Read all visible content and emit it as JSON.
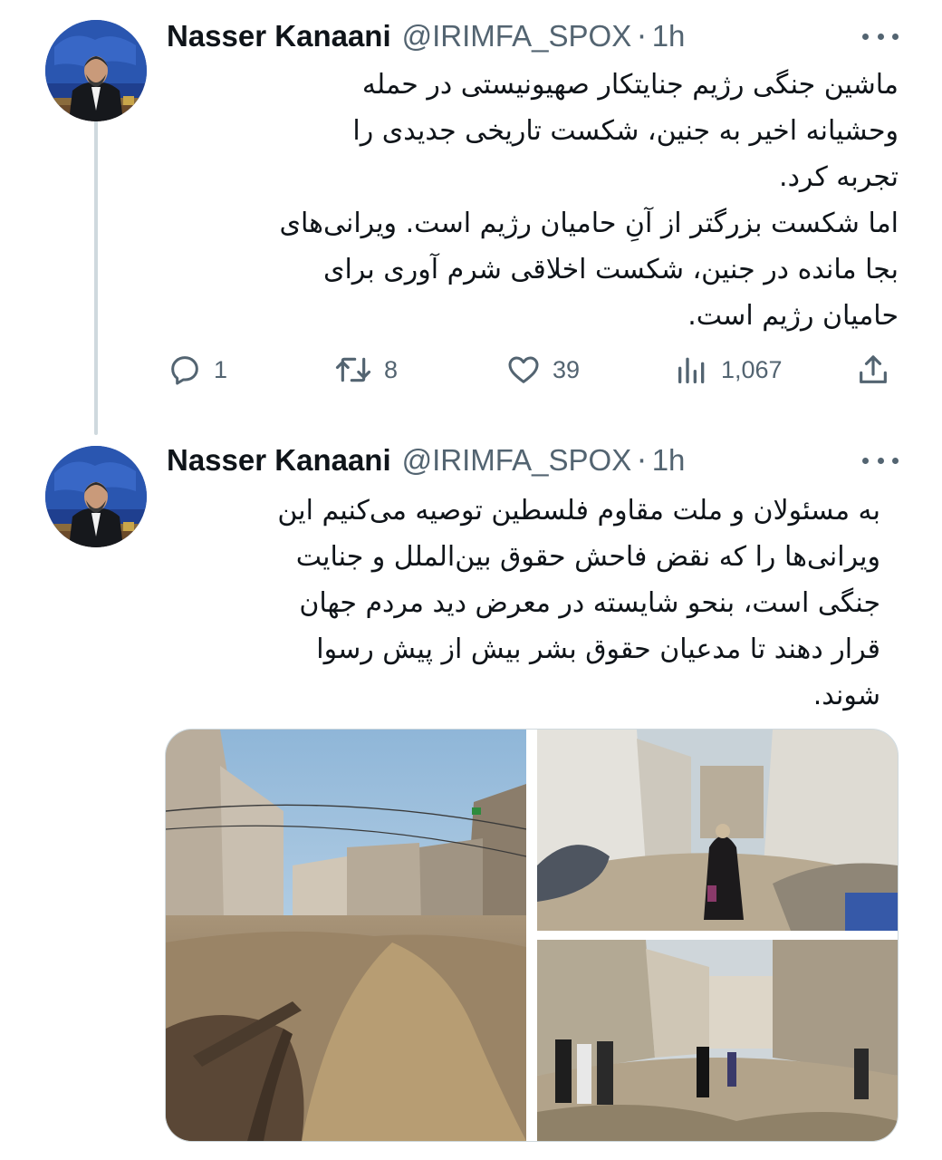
{
  "tweets": [
    {
      "author_name": "Nasser Kanaani",
      "handle": "@IRIMFA_SPOX",
      "separator": "·",
      "time": "1h",
      "text": "ماشین جنگی رژیم جنایتکار صهیونیستی در حمله\nوحشیانه اخیر به جنین، شکست تاریخی جدیدی را\nتجربه کرد.\nاما شکست بزرگتر از آنِ حامیان رژیم است. ویرانی‌های\nبجا مانده در جنین، شکست اخلاقی شرم آوری برای\nحامیان رژیم است.",
      "stats": {
        "replies": "1",
        "retweets": "8",
        "likes": "39",
        "views": "1,067"
      }
    },
    {
      "author_name": "Nasser Kanaani",
      "handle": "@IRIMFA_SPOX",
      "separator": "·",
      "time": "1h",
      "text": "به مسئولان و ملت مقاوم فلسطین توصیه می‌کنیم این\nویرانی‌ها را که نقض فاحش حقوق بین‌الملل و جنایت\nجنگی است، بنحو شایسته در معرض دید مردم جهان\nقرار دهند تا مدعیان حقوق بشر بیش از پیش رسوا\nشوند."
    }
  ],
  "icons": {
    "reply": "reply-icon",
    "retweet": "retweet-icon",
    "like": "heart-icon",
    "views": "views-icon",
    "share": "share-icon",
    "more": "more-dots-icon"
  },
  "colors": {
    "text": "#0f1419",
    "secondary": "#536471",
    "thread_line": "#cfd9de"
  }
}
